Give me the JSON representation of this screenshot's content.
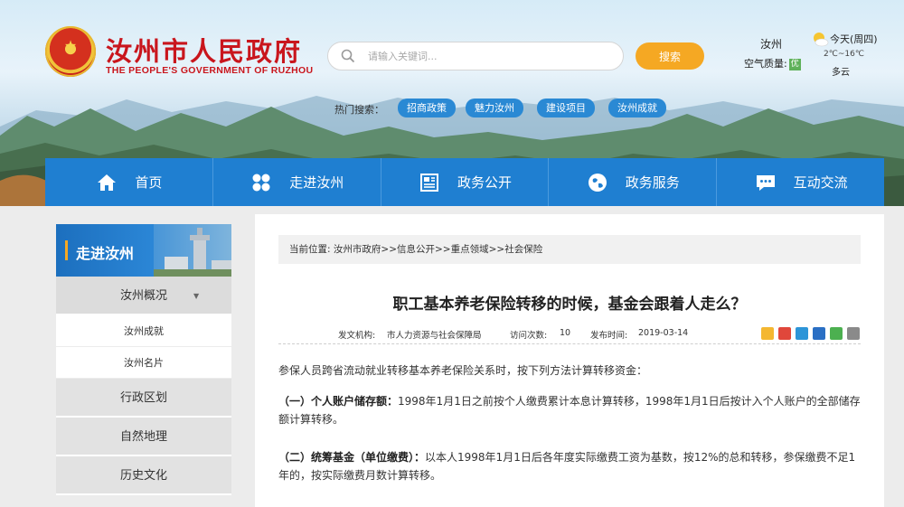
{
  "header": {
    "site_title": "汝州市人民政府",
    "site_subtitle": "THE PEOPLE'S GOVERNMENT OF RUZHOU",
    "emblem_icon": "national-emblem-icon",
    "search": {
      "placeholder": "请输入关键词...",
      "button_label": "搜索"
    },
    "weather": {
      "city": "汝州",
      "air_quality_label": "空气质量:",
      "air_quality_value": "优",
      "day": "今天(周四)",
      "temperature": "2℃~16℃",
      "description": "多云"
    },
    "hot_search": {
      "label": "热门搜索：",
      "tags": [
        "招商政策",
        "魅力汝州",
        "建设项目",
        "汝州成就"
      ]
    }
  },
  "nav": {
    "items": [
      {
        "label": "首页",
        "icon": "home-icon"
      },
      {
        "label": "走进汝州",
        "icon": "grid-icon"
      },
      {
        "label": "政务公开",
        "icon": "newspaper-icon"
      },
      {
        "label": "政务服务",
        "icon": "globe-icon"
      },
      {
        "label": "互动交流",
        "icon": "chat-icon"
      }
    ]
  },
  "sidebar": {
    "title": "走进汝州",
    "items": [
      {
        "label": "汝州概况",
        "caret": "▼"
      },
      {
        "label": "汝州成就"
      },
      {
        "label": "汝州名片"
      },
      {
        "label": "行政区划"
      },
      {
        "label": "自然地理"
      },
      {
        "label": "历史文化"
      }
    ]
  },
  "article": {
    "breadcrumb": {
      "prefix": "当前位置:",
      "items": [
        "汝州市政府",
        "信息公开",
        "重点领域",
        "社会保险"
      ],
      "separator": ">>"
    },
    "title": "职工基本养老保险转移的时候，基金会跟着人走么？",
    "meta": {
      "source_label": "发文机构:",
      "source": "市人力资源与社会保障局",
      "views_label": "访问次数:",
      "views": "10",
      "date_label": "发布时间:",
      "date": "2019-03-14"
    },
    "share_icons": [
      "qzone-icon",
      "weibo-icon",
      "tencent-weibo-icon",
      "renren-icon",
      "wechat-icon",
      "print-icon"
    ],
    "paragraphs": [
      {
        "bold": "",
        "text": "参保人员跨省流动就业转移基本养老保险关系时，按下列方法计算转移资金："
      },
      {
        "bold": "（一）个人账户储存额：",
        "text": "1998年1月1日之前按个人缴费累计本息计算转移，1998年1月1日后按计入个人账户的全部储存额计算转移。"
      },
      {
        "bold": "（二）统筹基金（单位缴费）：",
        "text": "以本人1998年1月1日后各年度实际缴费工资为基数，按12%的总和转移，参保缴费不足1年的，按实际缴费月数计算转移。"
      }
    ]
  },
  "colors": {
    "brand_red": "#c9161d",
    "nav_blue": "#1f7fd1",
    "search_orange": "#f5a823",
    "tag_blue": "#2a89d4"
  }
}
